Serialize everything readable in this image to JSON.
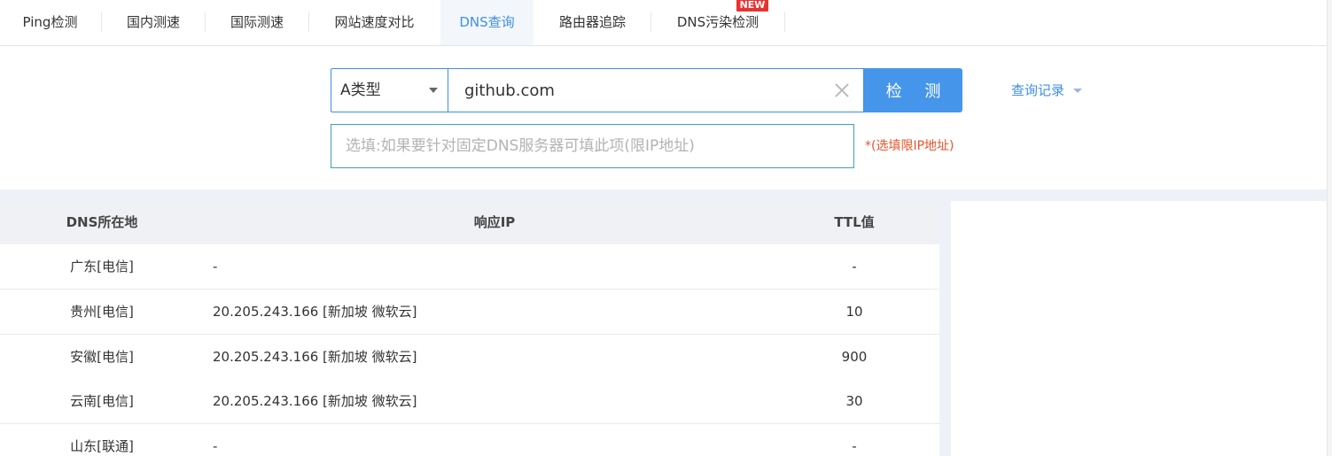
{
  "tabs": [
    {
      "label": "Ping检测",
      "active": false
    },
    {
      "label": "国内测速",
      "active": false
    },
    {
      "label": "国际测速",
      "active": false
    },
    {
      "label": "网站速度对比",
      "active": false
    },
    {
      "label": "DNS查询",
      "active": true
    },
    {
      "label": "路由器追踪",
      "active": false
    },
    {
      "label": "DNS污染检测",
      "active": false
    }
  ],
  "new_badge": "NEW",
  "query": {
    "type_value": "A类型",
    "domain_value": "github.com",
    "check_label": "检 测",
    "history_label": "查询记录",
    "dns_placeholder": "选填:如果要针对固定DNS服务器可填此项(限IP地址)",
    "dns_hint": "*(选填限IP地址)"
  },
  "table": {
    "headers": [
      "DNS所在地",
      "响应IP",
      "TTL值"
    ],
    "rows": [
      {
        "location": "广东[电信]",
        "ip": "-",
        "ttl": "-"
      },
      {
        "location": "贵州[电信]",
        "ip": "20.205.243.166 [新加坡 微软云]",
        "ttl": "10"
      },
      {
        "location": "安徽[电信]",
        "ip": "20.205.243.166 [新加坡 微软云]",
        "ttl": "900"
      },
      {
        "location": "云南[电信]",
        "ip": "20.205.243.166 [新加坡 微软云]",
        "ttl": "30"
      },
      {
        "location": "山东[联通]",
        "ip": "-",
        "ttl": "-"
      }
    ]
  },
  "colors": {
    "accent": "#3f8ee8",
    "button": "#4596ea",
    "hint": "#e8542a",
    "badge": "#e8322f"
  }
}
